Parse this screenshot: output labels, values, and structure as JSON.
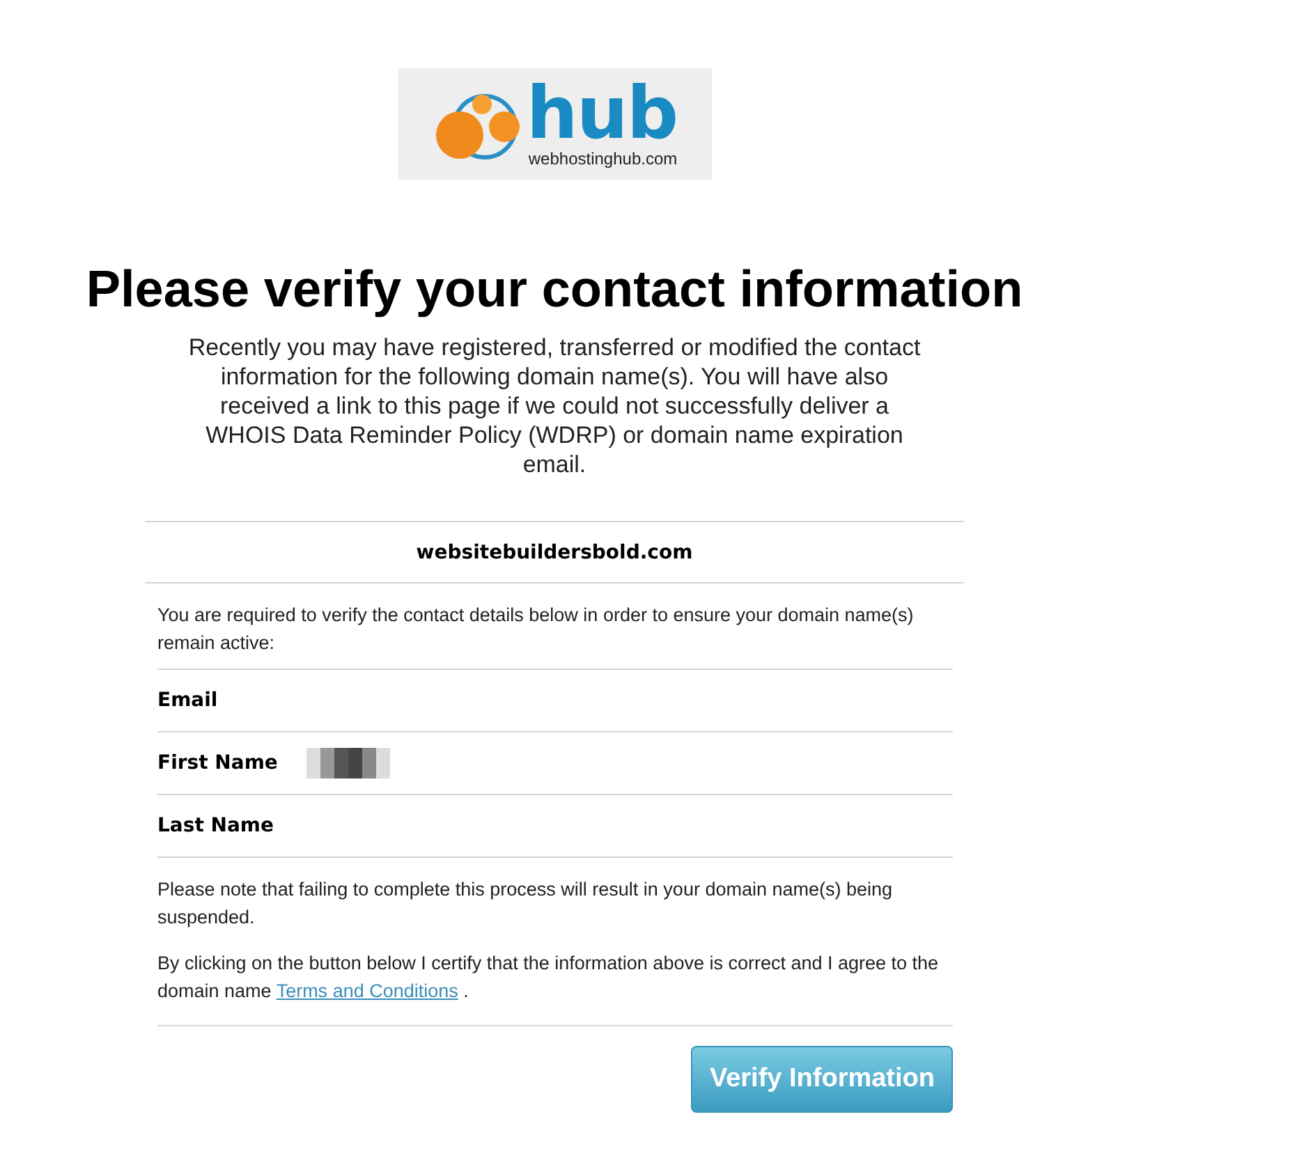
{
  "logo": {
    "wordmark": "hub",
    "tagline": "webhostinghub.com"
  },
  "heading": "Please verify your contact information",
  "intro": "Recently you may have registered, transferred or modified the contact information for the following domain name(s). You will have also received a link to this page if we could not successfully deliver a WHOIS Data Reminder Policy (WDRP) or domain name expiration email.",
  "domain": "websitebuildersbold.com",
  "instruction": "You are required to verify the contact details below in order to ensure your domain name(s) remain active:",
  "fields": [
    {
      "label": "Email",
      "redacted": false
    },
    {
      "label": "First Name",
      "redacted": true
    },
    {
      "label": "Last Name",
      "redacted": false
    }
  ],
  "warning": "Please note that failing to complete this process will result in your domain name(s) being suspended.",
  "agreement": {
    "text_before": "By clicking on the button below I certify that the information above is correct and I agree to the domain name",
    "link": "Terms and Conditions",
    "text_after": "."
  },
  "button": "Verify Information"
}
